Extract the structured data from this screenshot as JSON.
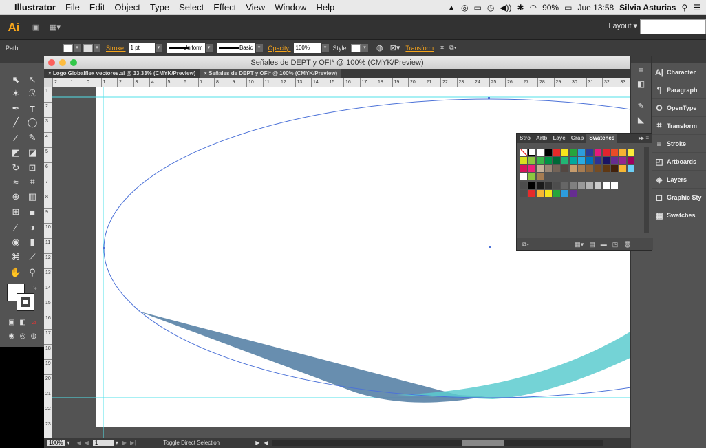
{
  "menubar": {
    "app_name": "Illustrator",
    "items": [
      "File",
      "Edit",
      "Object",
      "Type",
      "Select",
      "Effect",
      "View",
      "Window",
      "Help"
    ],
    "battery": "90%",
    "time": "Jue 13:58",
    "user": "Silvia Asturias"
  },
  "appbar": {
    "logo": "Ai",
    "workspace": "Layout"
  },
  "control": {
    "selection": "Path",
    "stroke_label": "Stroke:",
    "stroke_weight": "1 pt",
    "profile": "Uniform",
    "brush": "Basic",
    "opacity_label": "Opacity:",
    "opacity_value": "100%",
    "style_label": "Style:",
    "transform_label": "Transform"
  },
  "document": {
    "title": "Señales de DEPT y OFI* @ 100% (CMYK/Preview)",
    "tabs": [
      {
        "label": "Logo Globalflex vectores.ai @ 33.33% (CMYK/Preview)"
      },
      {
        "label": "Señales de DEPT y OFI* @ 100% (CMYK/Preview)"
      }
    ],
    "ruler_h": [
      "2",
      "1",
      "0",
      "1",
      "2",
      "3",
      "4",
      "5",
      "6",
      "7",
      "8",
      "9",
      "10",
      "11",
      "12",
      "13",
      "14",
      "15",
      "16",
      "17",
      "18",
      "19",
      "20",
      "21",
      "22",
      "23",
      "24",
      "25",
      "26",
      "27",
      "28",
      "29",
      "30",
      "31",
      "32",
      "33"
    ],
    "ruler_v": [
      "1",
      "2",
      "3",
      "4",
      "5",
      "6",
      "7",
      "8",
      "9",
      "10",
      "11",
      "12",
      "13",
      "14",
      "15",
      "16",
      "17",
      "18",
      "19",
      "20",
      "21",
      "22",
      "23"
    ],
    "zoom": "100%",
    "artboard_index": "1",
    "status_tool": "Toggle Direct Selection"
  },
  "panels": {
    "right_dock": [
      {
        "label": "Character",
        "icon": "character-icon"
      },
      {
        "label": "Paragraph",
        "icon": "paragraph-icon"
      },
      {
        "label": "OpenType",
        "icon": "opentype-icon"
      },
      {
        "label": "Transform",
        "icon": "transform-icon"
      },
      {
        "label": "Stroke",
        "icon": "stroke-icon"
      },
      {
        "label": "Artboards",
        "icon": "artboards-icon"
      },
      {
        "label": "Layers",
        "icon": "layers-icon"
      },
      {
        "label": "Graphic Sty",
        "icon": "graphic-styles-icon"
      },
      {
        "label": "Swatches",
        "icon": "swatches-icon"
      }
    ],
    "swatches_tabs": [
      "Stro",
      "Artb",
      "Laye",
      "Grap",
      "Swatches"
    ]
  },
  "colors": {
    "ellipse_stroke": "#4c72d8",
    "shape_blue": "#5b84a8",
    "shape_teal": "#5ccbcf",
    "guide": "#52e0ea"
  }
}
